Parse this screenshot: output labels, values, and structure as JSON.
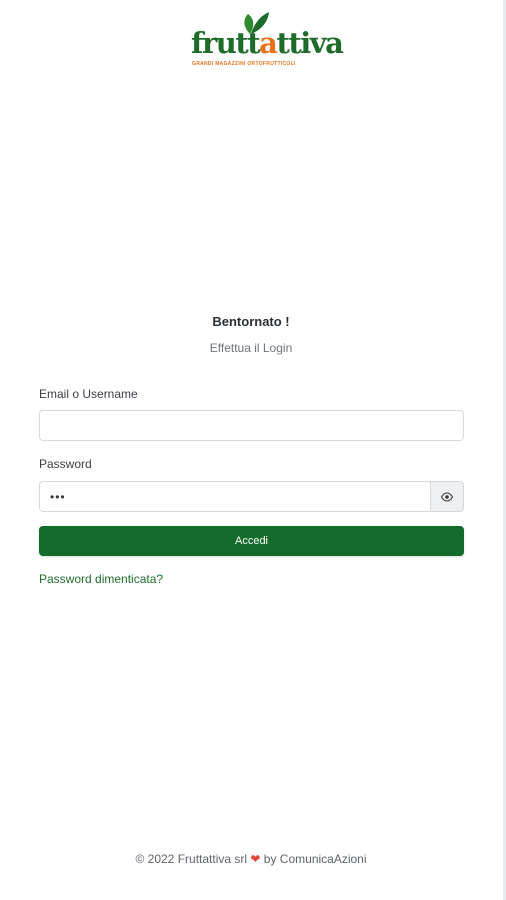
{
  "logo": {
    "brand_part1": "frutt",
    "brand_part2": "a",
    "brand_part3": "ttiva",
    "tagline": "GRANDI MAGAZZINI ORTOFRUTTICOLI",
    "brand_green": "#1f6b2a",
    "brand_orange": "#e8731c"
  },
  "header": {
    "title": "Bentornato !",
    "subtitle": "Effettua il Login"
  },
  "form": {
    "email_label": "Email o Username",
    "email_value": "",
    "password_label": "Password",
    "password_value": "•••",
    "toggle_icon": "eye-icon",
    "submit_label": "Accedi",
    "forgot_label": "Password dimenticata?",
    "accent_color": "#146c2b"
  },
  "footer": {
    "copyright": "© 2022 Fruttattiva srl",
    "heart_icon": "heart-icon",
    "by_text": "by ComunicaAzioni"
  }
}
